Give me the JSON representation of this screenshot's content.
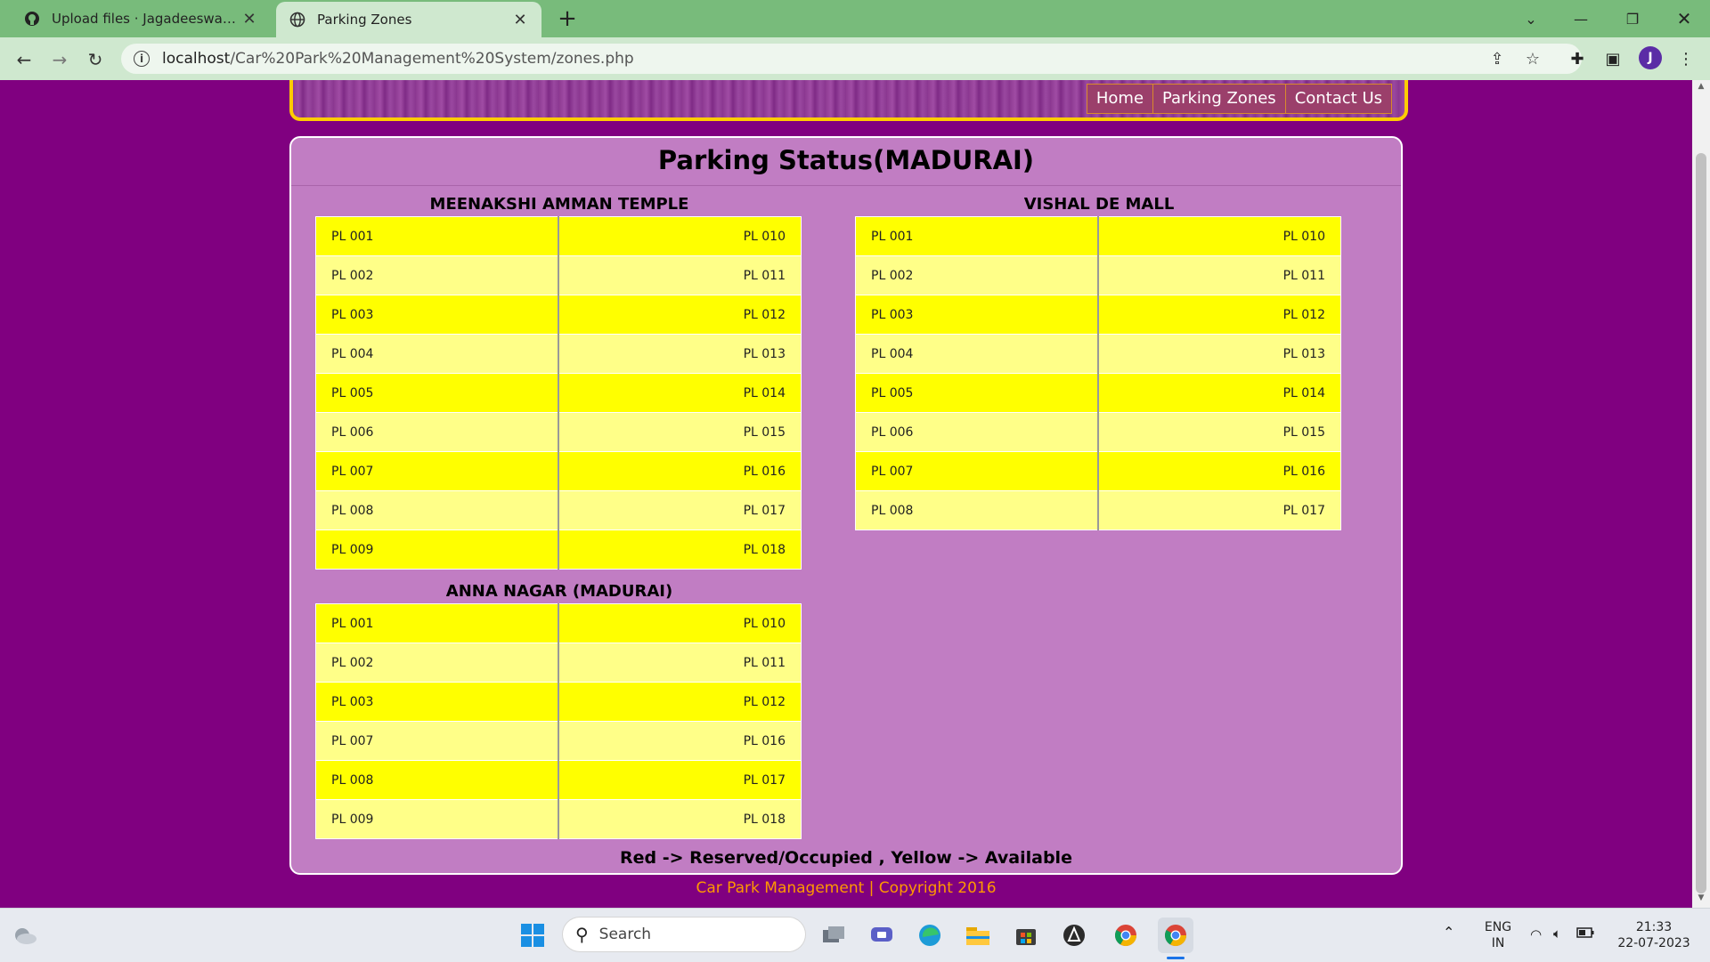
{
  "browser": {
    "tabs": [
      {
        "title": "Upload files · Jagadeeswaran-N/Car-Park-Management-System",
        "active": false,
        "icon": "github-icon"
      },
      {
        "title": "Parking Zones",
        "active": true,
        "icon": "globe-icon"
      }
    ],
    "url_host": "localhost",
    "url_path": "/Car%20Park%20Management%20System/zones.php",
    "profile_initial": "J"
  },
  "nav": {
    "home": "Home",
    "zones": "Parking Zones",
    "contact": "Contact Us"
  },
  "page": {
    "title": "Parking Status(MADURAI)",
    "legend": "Red -> Reserved/Occupied , Yellow -> Available",
    "footer": "Car Park Management | Copyright 2016"
  },
  "zones": [
    {
      "name": "MEENAKSHI AMMAN TEMPLE",
      "rows": [
        [
          "PL 001",
          "PL 010"
        ],
        [
          "PL 002",
          "PL 011"
        ],
        [
          "PL 003",
          "PL 012"
        ],
        [
          "PL 004",
          "PL 013"
        ],
        [
          "PL 005",
          "PL 014"
        ],
        [
          "PL 006",
          "PL 015"
        ],
        [
          "PL 007",
          "PL 016"
        ],
        [
          "PL 008",
          "PL 017"
        ],
        [
          "PL 009",
          "PL 018"
        ]
      ]
    },
    {
      "name": "VISHAL DE MALL",
      "rows": [
        [
          "PL 001",
          "PL 010"
        ],
        [
          "PL 002",
          "PL 011"
        ],
        [
          "PL 003",
          "PL 012"
        ],
        [
          "PL 004",
          "PL 013"
        ],
        [
          "PL 005",
          "PL 014"
        ],
        [
          "PL 006",
          "PL 015"
        ],
        [
          "PL 007",
          "PL 016"
        ],
        [
          "PL 008",
          "PL 017"
        ]
      ]
    },
    {
      "name": "ANNA NAGAR (MADURAI)",
      "rows": [
        [
          "PL 001",
          "PL 010"
        ],
        [
          "PL 002",
          "PL 011"
        ],
        [
          "PL 003",
          "PL 012"
        ],
        [
          "PL 007",
          "PL 016"
        ],
        [
          "PL 008",
          "PL 017"
        ],
        [
          "PL 009",
          "PL 018"
        ]
      ]
    }
  ],
  "colors": {
    "available_dark": "#ffff00",
    "available_light": "#ffff88",
    "page_bg": "#800080",
    "panel_bg": "#c17dc3"
  },
  "taskbar": {
    "search_placeholder": "Search",
    "lang_top": "ENG",
    "lang_bottom": "IN",
    "time": "21:33",
    "date": "22-07-2023"
  }
}
